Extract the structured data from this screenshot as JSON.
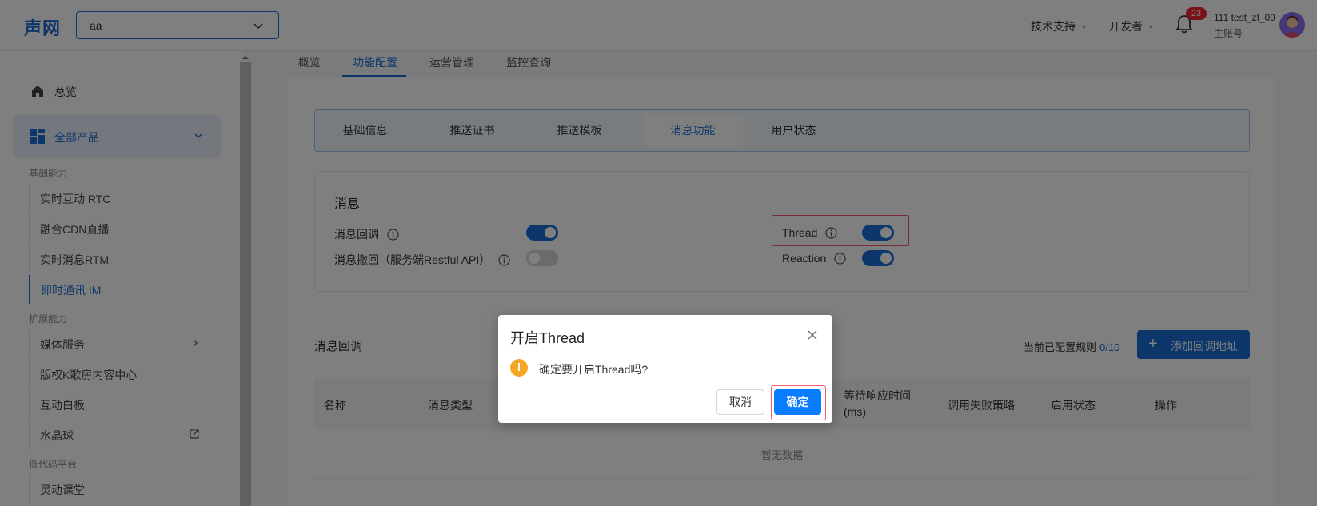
{
  "header": {
    "logo": "声网",
    "project_value": "aa",
    "menu_support": "技术支持",
    "menu_developer": "开发者",
    "notification_count": "23",
    "user_name": "111 test_zf_09",
    "user_role": "主账号"
  },
  "sidebar": {
    "overview": "总览",
    "all_products": "全部产品",
    "group_basic": "基础能力",
    "item_rtc": "实时互动 RTC",
    "item_cdn": "融合CDN直播",
    "item_rtm": "实时消息RTM",
    "item_im": "即时通讯 IM",
    "group_ext": "扩展能力",
    "item_media": "媒体服务",
    "item_ktv": "版权K歌房内容中心",
    "item_whiteboard": "互动白板",
    "item_crystal": "水晶球",
    "group_lowcode": "低代码平台",
    "item_classroom": "灵动课堂"
  },
  "main_tabs": [
    "概览",
    "功能配置",
    "运营管理",
    "监控查询"
  ],
  "sub_tabs": [
    "基础信息",
    "推送证书",
    "推送模板",
    "消息功能",
    "用户状态"
  ],
  "messages": {
    "title": "消息",
    "callback_label": "消息回调",
    "recall_label": "消息撤回（服务端Restful API）",
    "thread_label": "Thread",
    "reaction_label": "Reaction",
    "callback_on": true,
    "recall_on": false,
    "thread_on": true,
    "reaction_on": true
  },
  "callback": {
    "title": "消息回调",
    "rule_count_label": "当前已配置规则",
    "rule_count_value": "0/10",
    "add_button": "添加回调地址",
    "columns": [
      "名称",
      "消息类型",
      "等待响应时间(ms)",
      "调用失败策略",
      "启用状态",
      "操作"
    ],
    "empty": "暂无数据"
  },
  "modal": {
    "title": "开启Thread",
    "message": "确定要开启Thread吗?",
    "cancel": "取消",
    "confirm": "确定"
  },
  "colors": {
    "accent": "#1a6fd6",
    "confirm": "#0a7cff",
    "warning": "#f5a623",
    "highlight": "#f55a6e"
  }
}
